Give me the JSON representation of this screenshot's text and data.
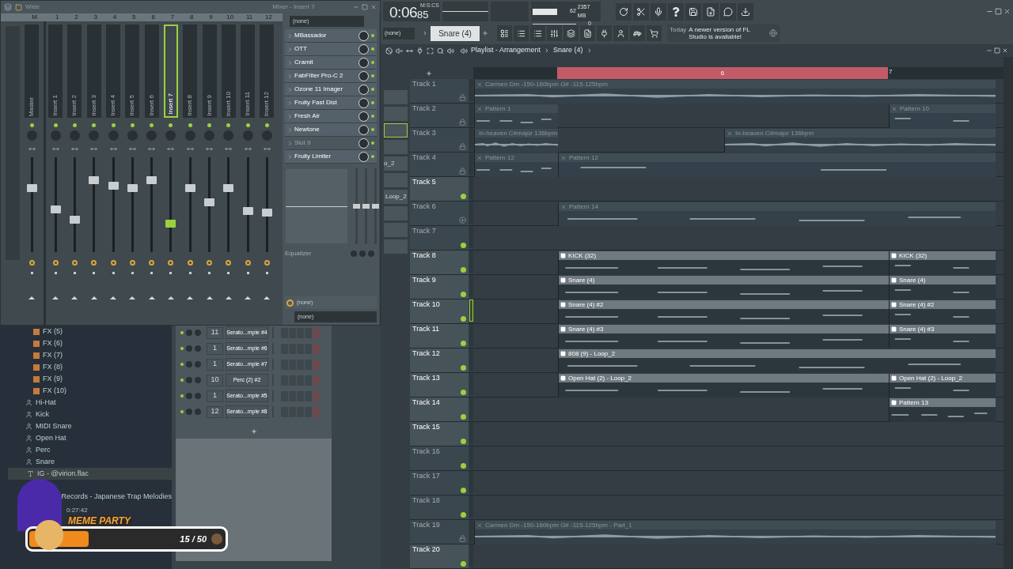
{
  "mixer": {
    "toolbar_label": "Wide",
    "title": "Mixer - Insert 7",
    "strips": [
      {
        "number": "M",
        "name": "Master",
        "level": 0.69,
        "selected": false
      },
      {
        "number": "1",
        "name": "Insert 1",
        "level": 0.45,
        "selected": false
      },
      {
        "number": "2",
        "name": "Insert 2",
        "level": 0.33,
        "selected": false
      },
      {
        "number": "3",
        "name": "Insert 3",
        "level": 0.78,
        "selected": false
      },
      {
        "number": "4",
        "name": "Insert 4",
        "level": 0.72,
        "selected": false
      },
      {
        "number": "5",
        "name": "Insert 5",
        "level": 0.69,
        "selected": false
      },
      {
        "number": "6",
        "name": "Insert 6",
        "level": 0.78,
        "selected": false
      },
      {
        "number": "7",
        "name": "Insert 7",
        "level": 0.28,
        "selected": true
      },
      {
        "number": "8",
        "name": "Insert 8",
        "level": 0.69,
        "selected": false
      },
      {
        "number": "9",
        "name": "Insert 9",
        "level": 0.53,
        "selected": false
      },
      {
        "number": "10",
        "name": "Insert 10",
        "level": 0.69,
        "selected": false
      },
      {
        "number": "11",
        "name": "Insert 11",
        "level": 0.43,
        "selected": false
      },
      {
        "number": "12",
        "name": "Insert 12",
        "level": 0.41,
        "selected": false
      }
    ],
    "input": "(none)",
    "slots": [
      {
        "name": "MBassador",
        "enabled": true
      },
      {
        "name": "OTT",
        "enabled": true
      },
      {
        "name": "Cramit",
        "enabled": true
      },
      {
        "name": "FabFilter Pro-C 2",
        "enabled": true
      },
      {
        "name": "Ozone 11 Imager",
        "enabled": true
      },
      {
        "name": "Fruity Fast Dist",
        "enabled": true
      },
      {
        "name": "Fresh Air",
        "enabled": true
      },
      {
        "name": "Newtone",
        "enabled": true
      },
      {
        "name": "Slot 9",
        "enabled": false
      },
      {
        "name": "Fruity Limiter",
        "enabled": true
      }
    ],
    "eq_bands": [
      {
        "level": 0.5
      },
      {
        "level": 0.5
      },
      {
        "level": 0.5
      }
    ],
    "eq_label": "Equalizer",
    "output_1": "(none)",
    "output_2": "(none)"
  },
  "toolbar": {
    "time": "0:06",
    "time_cs": "85",
    "time_unit": "M:S:CS",
    "cpu": "62",
    "memory": "2357 MB",
    "polyphony": "0",
    "pattern_input": "(none)",
    "pattern": "Snare (4)",
    "hint_day": "Today",
    "hint": "A newer version of FL Studio is available!"
  },
  "playlist": {
    "title": "Playlist - Arrangement",
    "pattern": "Snare (4)",
    "bar_labels": [
      "6",
      "7"
    ],
    "picker": [
      "o_2",
      "Loop_2"
    ],
    "tracks": [
      {
        "name": "Track 1",
        "dimmed": true,
        "locked": true,
        "enabled": true,
        "selected": false,
        "clips": [
          {
            "kind": "audio",
            "label": "Carmen Dm -150-160bpm G# -115-125bpm",
            "pre": true,
            "bar5": true,
            "bar6": true,
            "post": true
          }
        ]
      },
      {
        "name": "Track 2",
        "dimmed": true,
        "locked": true,
        "enabled": true,
        "selected": false,
        "clips": [
          {
            "kind": "pattern",
            "label": "Pattern 1",
            "pre": true,
            "bar5": false,
            "bar6": false,
            "post": false
          },
          {
            "kind": "pattern",
            "label": "Pattern 10",
            "pre": false,
            "bar5": false,
            "bar6": false,
            "post": true
          }
        ]
      },
      {
        "name": "Track 3",
        "dimmed": true,
        "locked": true,
        "enabled": true,
        "selected": false,
        "clips": [
          {
            "kind": "audio",
            "label": "In-heaven C#major 136bpm",
            "pre": true,
            "bar5": false,
            "bar6": false,
            "post": false
          },
          {
            "kind": "audio",
            "label": "In-heaven C#major 136bpm",
            "pre": false,
            "bar5": false,
            "bar6": true,
            "post": true
          }
        ]
      },
      {
        "name": "Track 4",
        "dimmed": true,
        "locked": true,
        "enabled": true,
        "selected": false,
        "clips": [
          {
            "kind": "pattern",
            "label": "Pattern 12",
            "pre": true,
            "bar5": false,
            "bar6": false,
            "post": false
          },
          {
            "kind": "pattern",
            "label": "Pattern 12",
            "pre": false,
            "bar5": true,
            "bar6": true,
            "post": true
          }
        ]
      },
      {
        "name": "Track 5",
        "dimmed": false,
        "locked": false,
        "enabled": true,
        "selected": false
      },
      {
        "name": "Track 6",
        "dimmed": true,
        "locked": false,
        "enabled": false,
        "selected": false,
        "clips": [
          {
            "kind": "pattern",
            "label": "Pattern 14",
            "pre": false,
            "bar5": true,
            "bar6": true,
            "post": true
          }
        ]
      },
      {
        "name": "Track 7",
        "dimmed": true,
        "locked": false,
        "enabled": true,
        "selected": false
      },
      {
        "name": "Track 8",
        "dimmed": false,
        "locked": false,
        "enabled": true,
        "selected": false,
        "clips": [
          {
            "kind": "pattern",
            "label": "KICK (32)",
            "pre": false,
            "bar5": true,
            "bar6": true,
            "post": false
          },
          {
            "kind": "pattern",
            "label": "KICK (32)",
            "pre": false,
            "bar5": false,
            "bar6": false,
            "post": true
          }
        ]
      },
      {
        "name": "Track 9",
        "dimmed": false,
        "locked": false,
        "enabled": true,
        "selected": false,
        "clips": [
          {
            "kind": "pattern",
            "label": "Snare (4)",
            "pre": false,
            "bar5": true,
            "bar6": true,
            "post": false
          },
          {
            "kind": "pattern",
            "label": "Snare (4)",
            "pre": false,
            "bar5": false,
            "bar6": false,
            "post": true
          }
        ]
      },
      {
        "name": "Track 10",
        "dimmed": false,
        "locked": false,
        "enabled": true,
        "selected": true,
        "clips": [
          {
            "kind": "pattern",
            "label": "Snare (4) #2",
            "pre": false,
            "bar5": true,
            "bar6": true,
            "post": false
          },
          {
            "kind": "pattern",
            "label": "Snare (4) #2",
            "pre": false,
            "bar5": false,
            "bar6": false,
            "post": true
          }
        ]
      },
      {
        "name": "Track 11",
        "dimmed": false,
        "locked": false,
        "enabled": true,
        "selected": false,
        "clips": [
          {
            "kind": "pattern",
            "label": "Snare (4) #3",
            "pre": false,
            "bar5": true,
            "bar6": true,
            "post": false
          },
          {
            "kind": "pattern",
            "label": "Snare (4) #3",
            "pre": false,
            "bar5": false,
            "bar6": false,
            "post": true
          }
        ]
      },
      {
        "name": "Track 12",
        "dimmed": false,
        "locked": false,
        "enabled": true,
        "selected": false,
        "clips": [
          {
            "kind": "pattern",
            "label": "808 (9) - Loop_2",
            "pre": false,
            "bar5": true,
            "bar6": true,
            "post": true
          }
        ]
      },
      {
        "name": "Track 13",
        "dimmed": false,
        "locked": false,
        "enabled": true,
        "selected": false,
        "clips": [
          {
            "kind": "pattern",
            "label": "Open Hat (2) - Loop_2",
            "pre": false,
            "bar5": true,
            "bar6": true,
            "post": false
          },
          {
            "kind": "pattern",
            "label": "Open Hat (2) - Loop_2",
            "pre": false,
            "bar5": false,
            "bar6": false,
            "post": true
          }
        ]
      },
      {
        "name": "Track 14",
        "dimmed": false,
        "locked": false,
        "enabled": true,
        "selected": false,
        "clips": [
          {
            "kind": "pattern",
            "label": "Pattern 13",
            "pre": false,
            "bar5": false,
            "bar6": false,
            "post": true
          }
        ]
      },
      {
        "name": "Track 15",
        "dimmed": false,
        "locked": false,
        "enabled": true,
        "selected": false
      },
      {
        "name": "Track 16",
        "dimmed": true,
        "locked": false,
        "enabled": true,
        "selected": false
      },
      {
        "name": "Track 17",
        "dimmed": true,
        "locked": false,
        "enabled": true,
        "selected": false
      },
      {
        "name": "Track 18",
        "dimmed": true,
        "locked": false,
        "enabled": true,
        "selected": false
      },
      {
        "name": "Track 19",
        "dimmed": true,
        "locked": true,
        "enabled": true,
        "selected": false,
        "clips": [
          {
            "kind": "audio",
            "label": "Carmen Dm -150-160bpm G# -115-125bpm - Part_1",
            "pre": true,
            "bar5": true,
            "bar6": true,
            "post": true
          }
        ]
      },
      {
        "name": "Track 20",
        "dimmed": false,
        "locked": false,
        "enabled": true,
        "selected": false
      }
    ]
  },
  "browser": {
    "items": [
      {
        "kind": "fx",
        "label": "FX (5)"
      },
      {
        "kind": "fx",
        "label": "FX (6)"
      },
      {
        "kind": "fx",
        "label": "FX (7)"
      },
      {
        "kind": "fx",
        "label": "FX (8)"
      },
      {
        "kind": "fx",
        "label": "FX (9)"
      },
      {
        "kind": "fx",
        "label": "FX (10)"
      },
      {
        "kind": "instrument",
        "label": "Hi-Hat"
      },
      {
        "kind": "instrument",
        "label": "Kick"
      },
      {
        "kind": "instrument",
        "label": "MIDI Snare"
      },
      {
        "kind": "instrument",
        "label": "Open Hat"
      },
      {
        "kind": "instrument",
        "label": "Perc"
      },
      {
        "kind": "instrument",
        "label": "Snare"
      },
      {
        "kind": "file",
        "label": "IG - @virion.flac"
      },
      {
        "kind": "folder",
        "label": "Records - Japanese Trap Melodies"
      }
    ],
    "duration": "0:27:42"
  },
  "channel_rack": {
    "rows": [
      {
        "number": "11",
        "name": "Serato...mple #4"
      },
      {
        "number": "1",
        "name": "Serato...mple #6"
      },
      {
        "number": "1",
        "name": "Serato...mple #7"
      },
      {
        "number": "10",
        "name": "Perc (2) #2"
      },
      {
        "number": "1",
        "name": "Serato...mple #5"
      },
      {
        "number": "12",
        "name": "Serato...mple #8"
      }
    ]
  },
  "overlay": {
    "title": "MEME PARTY",
    "count": "15 / 50",
    "level": 0.3
  }
}
